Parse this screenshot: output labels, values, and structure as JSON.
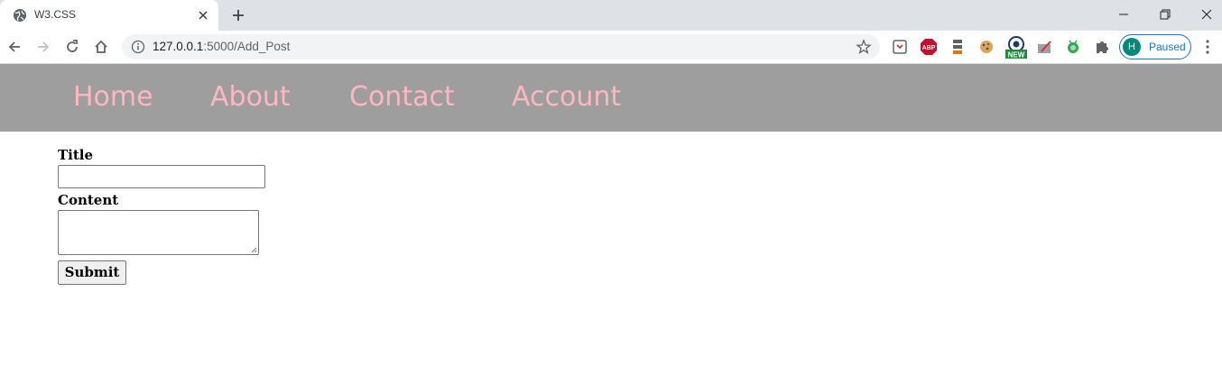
{
  "browser": {
    "tab": {
      "title": "W3.CSS"
    },
    "address": {
      "host": "127.0.0.1",
      "path": ":5000/Add_Post"
    },
    "profile": {
      "initial": "H",
      "status": "Paused"
    },
    "extensions": [
      "clipper-icon",
      "adblock-plus-icon",
      "stack-icon",
      "cookie-icon",
      "tracker-new-icon",
      "eraser-icon",
      "bug-icon",
      "puzzle-icon"
    ],
    "extension_badge": "NEW",
    "extension_abp_text": "ABP"
  },
  "navbar": {
    "items": [
      {
        "label": "Home"
      },
      {
        "label": "About"
      },
      {
        "label": "Contact"
      },
      {
        "label": "Account"
      }
    ],
    "colors": {
      "background": "#9e9e9e",
      "text": "#ffb6c1"
    }
  },
  "form": {
    "title_label": "Title",
    "title_value": "",
    "content_label": "Content",
    "content_value": "",
    "submit_label": "Submit"
  }
}
